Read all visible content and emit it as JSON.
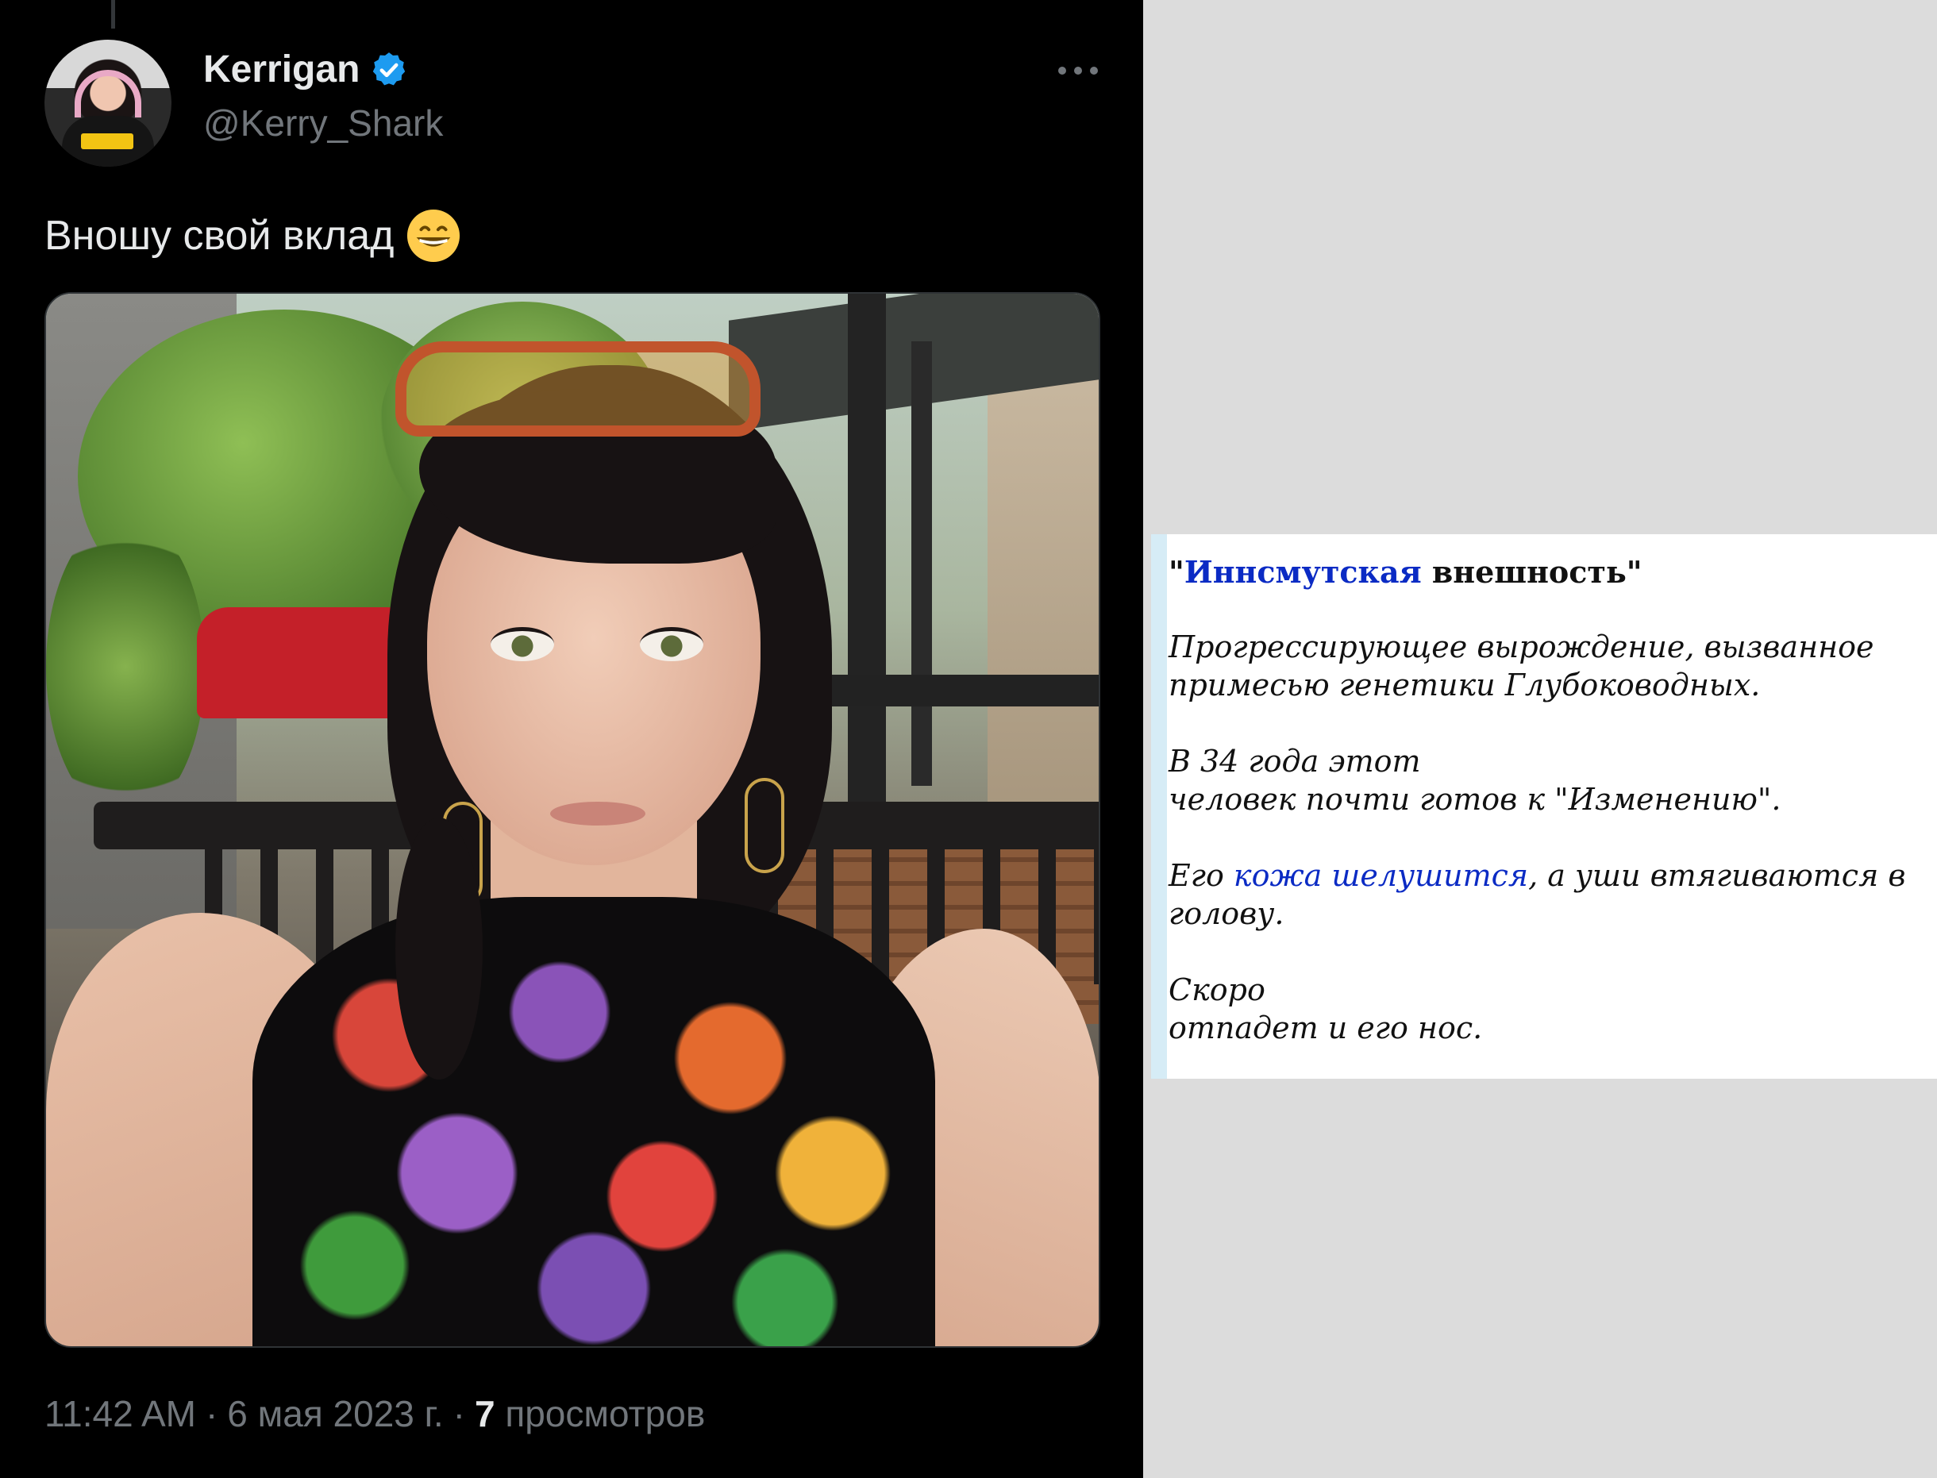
{
  "tweet": {
    "display_name": "Kerrigan",
    "handle": "@Kerry_Shark",
    "text": "Вношу свой вклад",
    "icons": {
      "verified": "verified-badge-icon",
      "more": "more-options-icon",
      "emoji": "grinning-face-emoji"
    },
    "meta": {
      "time": "11:42 AM",
      "separator": "·",
      "date": "6 мая 2023 г.",
      "views_count": "7",
      "views_label": "просмотров"
    },
    "colors": {
      "background": "#000000",
      "text": "#e7e9ea",
      "secondary": "#71767b",
      "verified": "#1d9bf0"
    }
  },
  "wiki": {
    "title_open_quote": "\"",
    "title_link": "Иннсмутская",
    "title_rest": " внешность\"",
    "p1": "Прогрессирующее вырождение, вызванное примесью генетики Глубоководных.",
    "p2_line1": "В 34 года этот",
    "p2_line2": "человек почти готов к \"Изменению\".",
    "p3_pre": "Его ",
    "p3_link": "кожа шелушится",
    "p3_post": ", а уши втягиваются в голову.",
    "p4_line1": "Скоро",
    "p4_line2": "отпадет и его нос.",
    "colors": {
      "link": "#0b2bc4",
      "accent_bar": "#d6ecf6"
    }
  }
}
